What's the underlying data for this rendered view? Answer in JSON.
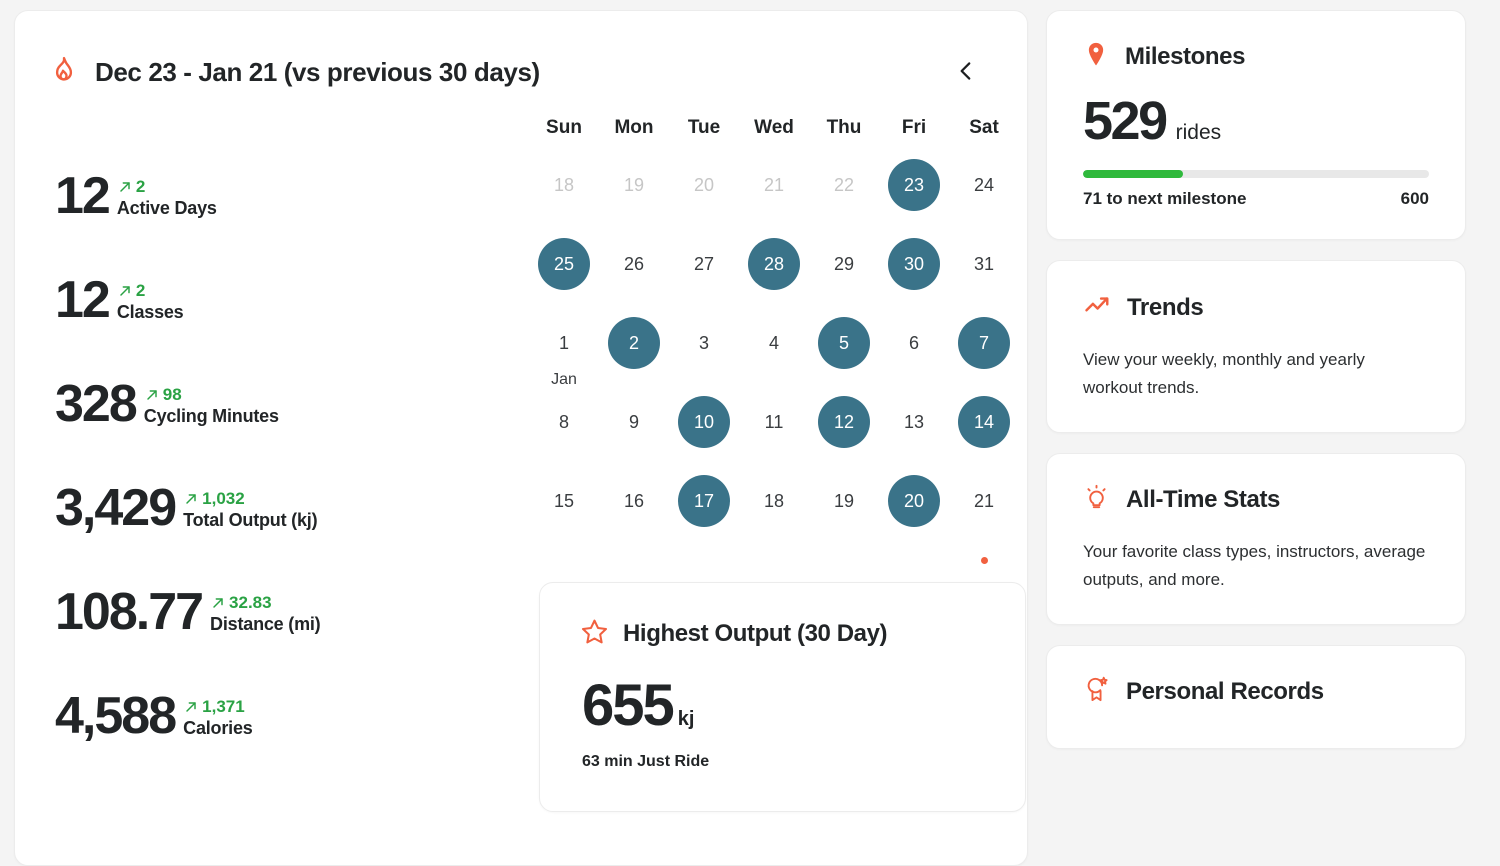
{
  "header": {
    "flame_icon": "flame-icon",
    "title": "Dec 23 - Jan 21 (vs previous 30 days)",
    "back_icon": "chevron-left-icon"
  },
  "colors": {
    "accent_orange": "#f1603f",
    "positive_green": "#2aa244",
    "progress_green": "#2fb93c",
    "calendar_active_teal": "#3a7389",
    "muted_gray": "#c6c6c6"
  },
  "stats": [
    {
      "value": "12",
      "delta": "2",
      "label": "Active Days"
    },
    {
      "value": "12",
      "delta": "2",
      "label": "Classes"
    },
    {
      "value": "328",
      "delta": "98",
      "label": "Cycling Minutes"
    },
    {
      "value": "3,429",
      "delta": "1,032",
      "label": "Total Output (kj)"
    },
    {
      "value": "108.77",
      "delta": "32.83",
      "label": "Distance (mi)"
    },
    {
      "value": "4,588",
      "delta": "1,371",
      "label": "Calories"
    }
  ],
  "calendar": {
    "weekdays": [
      "Sun",
      "Mon",
      "Tue",
      "Wed",
      "Thu",
      "Fri",
      "Sat"
    ],
    "month_label": "Jan",
    "month_label_index": 14,
    "today_dot_index": 34,
    "days": [
      {
        "n": "18",
        "state": "muted"
      },
      {
        "n": "19",
        "state": "muted"
      },
      {
        "n": "20",
        "state": "muted"
      },
      {
        "n": "21",
        "state": "muted"
      },
      {
        "n": "22",
        "state": "muted"
      },
      {
        "n": "23",
        "state": "active"
      },
      {
        "n": "24",
        "state": "normal"
      },
      {
        "n": "25",
        "state": "active"
      },
      {
        "n": "26",
        "state": "normal"
      },
      {
        "n": "27",
        "state": "normal"
      },
      {
        "n": "28",
        "state": "active"
      },
      {
        "n": "29",
        "state": "normal"
      },
      {
        "n": "30",
        "state": "active"
      },
      {
        "n": "31",
        "state": "normal"
      },
      {
        "n": "1",
        "state": "normal"
      },
      {
        "n": "2",
        "state": "active"
      },
      {
        "n": "3",
        "state": "normal"
      },
      {
        "n": "4",
        "state": "normal"
      },
      {
        "n": "5",
        "state": "active"
      },
      {
        "n": "6",
        "state": "normal"
      },
      {
        "n": "7",
        "state": "active"
      },
      {
        "n": "8",
        "state": "normal"
      },
      {
        "n": "9",
        "state": "normal"
      },
      {
        "n": "10",
        "state": "active"
      },
      {
        "n": "11",
        "state": "normal"
      },
      {
        "n": "12",
        "state": "active"
      },
      {
        "n": "13",
        "state": "normal"
      },
      {
        "n": "14",
        "state": "active"
      },
      {
        "n": "15",
        "state": "normal"
      },
      {
        "n": "16",
        "state": "normal"
      },
      {
        "n": "17",
        "state": "active"
      },
      {
        "n": "18",
        "state": "normal"
      },
      {
        "n": "19",
        "state": "normal"
      },
      {
        "n": "20",
        "state": "active"
      },
      {
        "n": "21",
        "state": "normal"
      }
    ]
  },
  "highest_output": {
    "icon": "star-icon",
    "title": "Highest Output (30 Day)",
    "value": "655",
    "unit": "kj",
    "subtitle": "63 min Just Ride"
  },
  "sidebar": {
    "milestones": {
      "icon": "map-pin-icon",
      "title": "Milestones",
      "value": "529",
      "unit": "rides",
      "progress_percent": 29,
      "remaining_text": "71 to next milestone",
      "goal": "600"
    },
    "trends": {
      "icon": "trending-up-icon",
      "title": "Trends",
      "description": "View your weekly, monthly and yearly workout trends."
    },
    "all_time_stats": {
      "icon": "lightbulb-icon",
      "title": "All-Time Stats",
      "description": "Your favorite class types, instructors, average outputs, and more."
    },
    "personal_records": {
      "icon": "award-icon",
      "title": "Personal Records"
    }
  }
}
